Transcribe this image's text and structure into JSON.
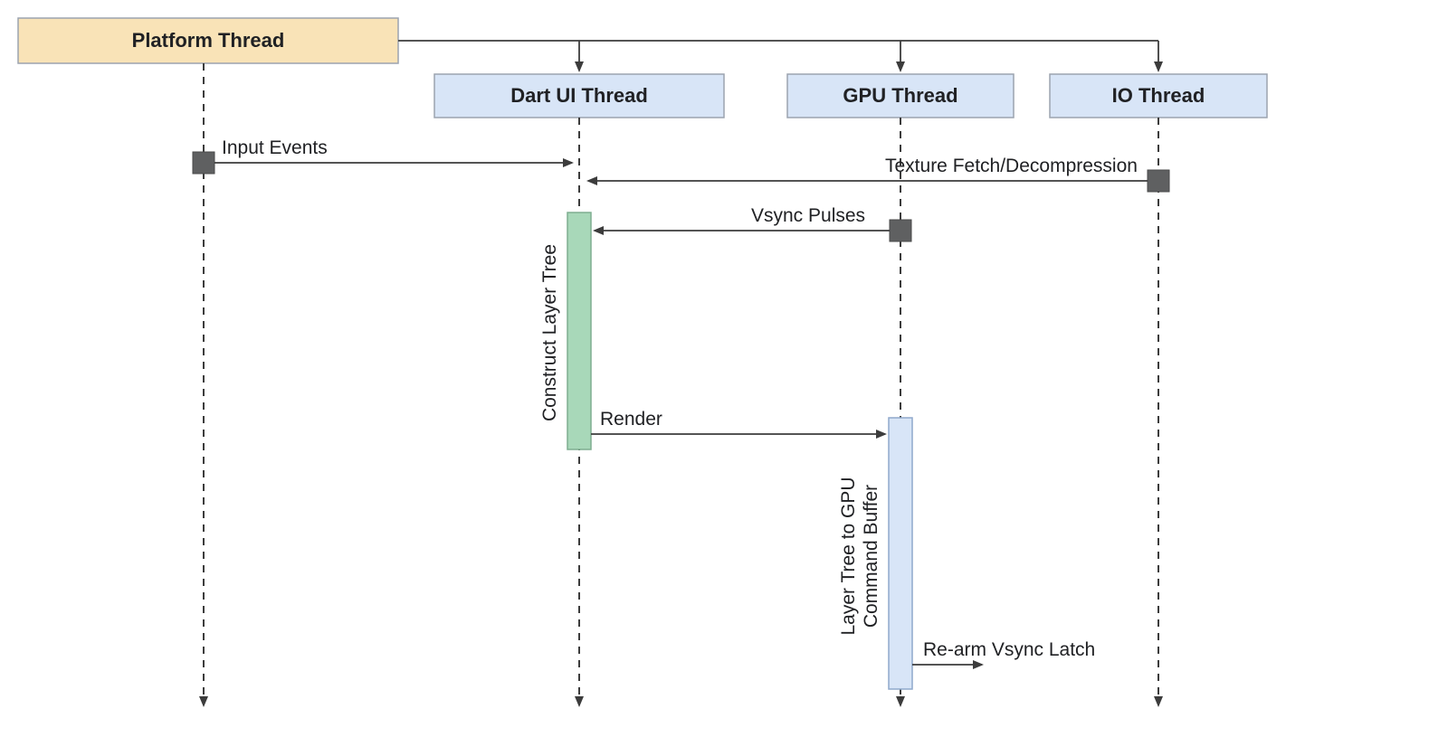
{
  "threads": {
    "platform": "Platform Thread",
    "dart": "Dart UI Thread",
    "gpu": "GPU Thread",
    "io": "IO Thread"
  },
  "messages": {
    "input_events": "Input Events",
    "texture_fetch": "Texture Fetch/Decompression",
    "vsync_pulses": "Vsync Pulses",
    "render": "Render",
    "rearm": "Re-arm Vsync Latch"
  },
  "activations": {
    "construct_layer_tree": "Construct Layer Tree",
    "layer_tree_gpu_line1": "Layer Tree to GPU",
    "layer_tree_gpu_line2": "Command Buffer"
  },
  "colors": {
    "platform_fill": "#f9e3b7",
    "child_fill": "#d8e5f7",
    "activation_green": "#a8d8b9",
    "node_gray": "#5f6061"
  }
}
